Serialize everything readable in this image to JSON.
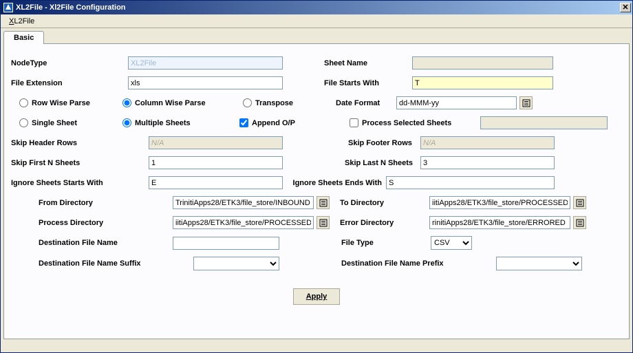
{
  "title": "XL2File - Xl2File Configuration",
  "menu": {
    "xl2file": "XL2File"
  },
  "tab": {
    "basic": "Basic"
  },
  "labels": {
    "nodeType": "NodeType",
    "sheetName": "Sheet Name",
    "fileExtension": "File Extension",
    "fileStartsWith": "File Starts With",
    "rowWise": "Row Wise Parse",
    "colWise": "Column Wise Parse",
    "transpose": "Transpose",
    "dateFormat": "Date Format",
    "singleSheet": "Single Sheet",
    "multipleSheets": "Multiple Sheets",
    "appendOP": "Append O/P",
    "processSelected": "Process Selected Sheets",
    "skipHeaderRows": "Skip Header Rows",
    "skipFooterRows": "Skip Footer Rows",
    "skipFirstN": "Skip First N Sheets",
    "skipLastN": "Skip Last N Sheets",
    "ignoreStarts": "Ignore Sheets Starts With",
    "ignoreEnds": "Ignore Sheets Ends With",
    "fromDir": "From Directory",
    "toDir": "To Directory",
    "processDir": "Process Directory",
    "errorDir": "Error Directory",
    "destFileName": "Destination File Name",
    "fileType": "File Type",
    "destSuffix": "Destination File Name Suffix",
    "destPrefix": "Destination File Name Prefix"
  },
  "values": {
    "nodeType": "XL2File",
    "sheetName": "",
    "fileExtension": "xls",
    "fileStartsWith": "T",
    "dateFormat": "dd-MMM-yy",
    "skipHeaderRows": "N/A",
    "skipFooterRows": "N/A",
    "skipFirstN": "1",
    "skipLastN": "3",
    "ignoreStarts": "E",
    "ignoreEnds": "S",
    "fromDir": "TrinitiApps28/ETK3/file_store/INBOUND",
    "toDir": "iitiApps28/ETK3/file_store/PROCESSED",
    "processDir": "iitiApps28/ETK3/file_store/PROCESSED",
    "errorDir": "rinitiApps28/ETK3/file_store/ERRORED",
    "destFileName": "",
    "fileType": "CSV",
    "destSuffix": "",
    "destPrefix": ""
  },
  "buttons": {
    "apply": "Apply"
  }
}
